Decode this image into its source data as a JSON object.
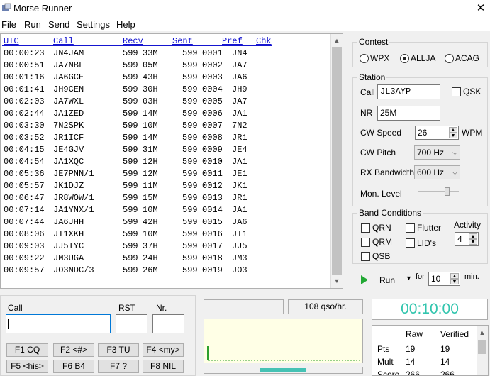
{
  "window": {
    "title": "Morse Runner",
    "close_glyph": "✕"
  },
  "menu": [
    "File",
    "Run",
    "Send",
    "Settings",
    "Help"
  ],
  "log": {
    "headers": [
      "UTC",
      "Call",
      "Recv",
      "Sent",
      "Pref",
      "Chk"
    ],
    "rows": [
      {
        "utc": "00:00:23",
        "call": "JN4JAM",
        "rst_r": "599",
        "recv": "33M",
        "rst_s": "599",
        "sent": "0001",
        "pref": "JN4"
      },
      {
        "utc": "00:00:51",
        "call": "JA7NBL",
        "rst_r": "599",
        "recv": "05M",
        "rst_s": "599",
        "sent": "0002",
        "pref": "JA7"
      },
      {
        "utc": "00:01:16",
        "call": "JA6GCE",
        "rst_r": "599",
        "recv": "43H",
        "rst_s": "599",
        "sent": "0003",
        "pref": "JA6"
      },
      {
        "utc": "00:01:41",
        "call": "JH9CEN",
        "rst_r": "599",
        "recv": "30H",
        "rst_s": "599",
        "sent": "0004",
        "pref": "JH9"
      },
      {
        "utc": "00:02:03",
        "call": "JA7WXL",
        "rst_r": "599",
        "recv": "03H",
        "rst_s": "599",
        "sent": "0005",
        "pref": "JA7"
      },
      {
        "utc": "00:02:44",
        "call": "JA1ZED",
        "rst_r": "599",
        "recv": "14M",
        "rst_s": "599",
        "sent": "0006",
        "pref": "JA1"
      },
      {
        "utc": "00:03:30",
        "call": "7N2SPK",
        "rst_r": "599",
        "recv": "10M",
        "rst_s": "599",
        "sent": "0007",
        "pref": "7N2"
      },
      {
        "utc": "00:03:52",
        "call": "JR1ICF",
        "rst_r": "599",
        "recv": "14M",
        "rst_s": "599",
        "sent": "0008",
        "pref": "JR1"
      },
      {
        "utc": "00:04:15",
        "call": "JE4GJV",
        "rst_r": "599",
        "recv": "31M",
        "rst_s": "599",
        "sent": "0009",
        "pref": "JE4"
      },
      {
        "utc": "00:04:54",
        "call": "JA1XQC",
        "rst_r": "599",
        "recv": "12H",
        "rst_s": "599",
        "sent": "0010",
        "pref": "JA1"
      },
      {
        "utc": "00:05:36",
        "call": "JE7PNN/1",
        "rst_r": "599",
        "recv": "12M",
        "rst_s": "599",
        "sent": "0011",
        "pref": "JE1"
      },
      {
        "utc": "00:05:57",
        "call": "JK1DJZ",
        "rst_r": "599",
        "recv": "11M",
        "rst_s": "599",
        "sent": "0012",
        "pref": "JK1"
      },
      {
        "utc": "00:06:47",
        "call": "JR8WOW/1",
        "rst_r": "599",
        "recv": "15M",
        "rst_s": "599",
        "sent": "0013",
        "pref": "JR1"
      },
      {
        "utc": "00:07:14",
        "call": "JA1YNX/1",
        "rst_r": "599",
        "recv": "10M",
        "rst_s": "599",
        "sent": "0014",
        "pref": "JA1"
      },
      {
        "utc": "00:07:44",
        "call": "JA6JHH",
        "rst_r": "599",
        "recv": "42H",
        "rst_s": "599",
        "sent": "0015",
        "pref": "JA6"
      },
      {
        "utc": "00:08:06",
        "call": "JI1XKH",
        "rst_r": "599",
        "recv": "10M",
        "rst_s": "599",
        "sent": "0016",
        "pref": "JI1"
      },
      {
        "utc": "00:09:03",
        "call": "JJ5IYC",
        "rst_r": "599",
        "recv": "37H",
        "rst_s": "599",
        "sent": "0017",
        "pref": "JJ5"
      },
      {
        "utc": "00:09:22",
        "call": "JM3UGA",
        "rst_r": "599",
        "recv": "24H",
        "rst_s": "599",
        "sent": "0018",
        "pref": "JM3"
      },
      {
        "utc": "00:09:57",
        "call": "JO3NDC/3",
        "rst_r": "599",
        "recv": "26M",
        "rst_s": "599",
        "sent": "0019",
        "pref": "JO3"
      }
    ]
  },
  "contest": {
    "title": "Contest",
    "options": [
      {
        "label": "WPX",
        "selected": false
      },
      {
        "label": "ALLJA",
        "selected": true
      },
      {
        "label": "ACAG",
        "selected": false
      }
    ]
  },
  "station": {
    "title": "Station",
    "call_label": "Call",
    "call_value": "JL3AYP",
    "qsk_label": "QSK",
    "nr_label": "NR",
    "nr_value": "25M",
    "cw_speed_label": "CW Speed",
    "cw_speed_value": "26",
    "cw_speed_unit": "WPM",
    "cw_pitch_label": "CW Pitch",
    "cw_pitch_value": "700 Hz",
    "rx_bw_label": "RX Bandwidth",
    "rx_bw_value": "600 Hz",
    "mon_level_label": "Mon. Level",
    "mon_level_fraction": 0.75
  },
  "band": {
    "title": "Band Conditions",
    "qrn": "QRN",
    "flutter": "Flutter",
    "qrm": "QRM",
    "lids": "LID's",
    "qsb": "QSB",
    "activity_label": "Activity",
    "activity_value": "4"
  },
  "run": {
    "label": "Run",
    "for_label": "for",
    "minutes_value": "10",
    "min_label": "min."
  },
  "entry": {
    "call_label": "Call",
    "rst_label": "RST",
    "nr_label": "Nr.",
    "call_value": "",
    "rst_value": "",
    "nr_value": ""
  },
  "fkeys": [
    "F1 CQ",
    "F2 <#>",
    "F3 TU",
    "F4 <my>",
    "F5 <his>",
    "F6 B4",
    "F7 ?",
    "F8 NIL"
  ],
  "status": {
    "rate": "108 qso/hr.",
    "rate_progress": 0.29
  },
  "clock": "00:10:00",
  "score": {
    "headers": [
      "Raw",
      "Verified"
    ],
    "rows": [
      {
        "label": "Pts",
        "raw": "19",
        "verified": "19"
      },
      {
        "label": "Mult",
        "raw": "14",
        "verified": "14"
      },
      {
        "label": "Score",
        "raw": "266",
        "verified": "266"
      }
    ]
  },
  "colors": {
    "header_blue": "#1515d0",
    "clock_teal": "#32c5ae",
    "graph_bg": "#ffffe6",
    "run_green": "#22a834"
  }
}
